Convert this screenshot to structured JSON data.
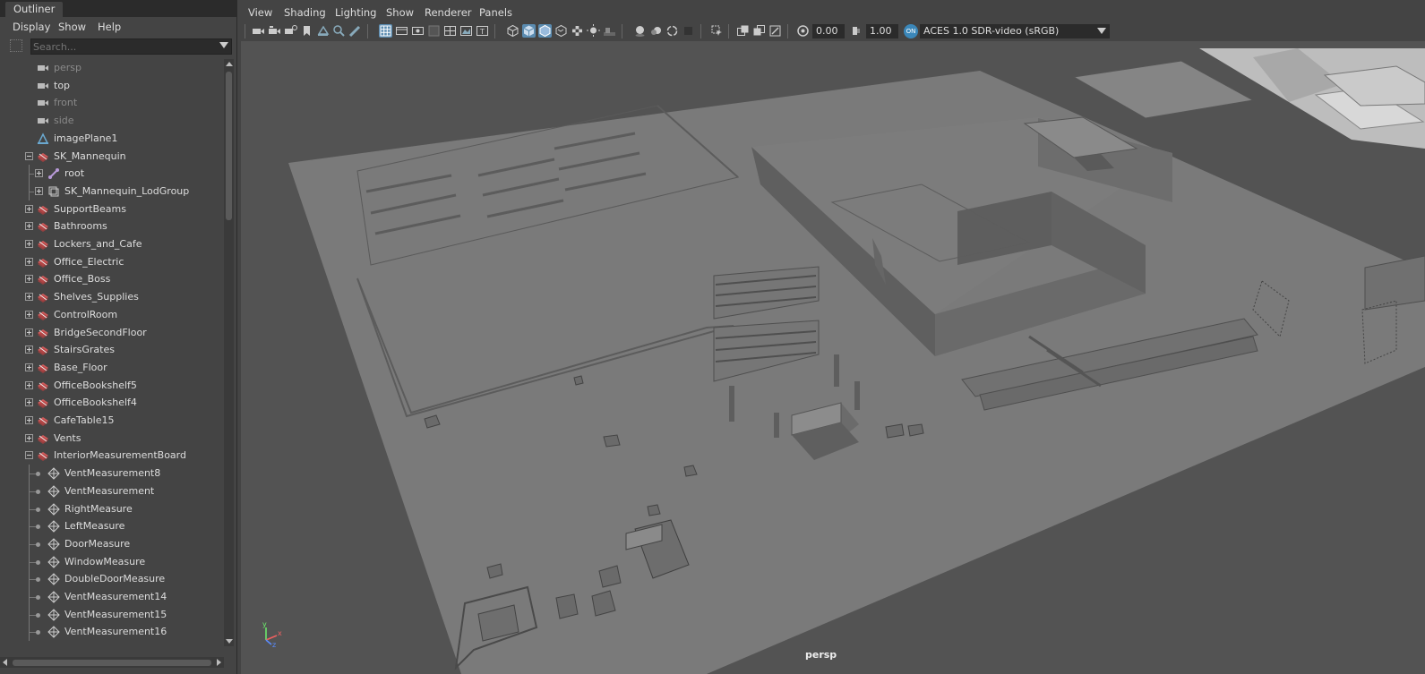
{
  "outliner": {
    "tab_title": "Outliner",
    "menus": [
      "Display",
      "Show",
      "Help"
    ],
    "search_placeholder": "Search...",
    "items": [
      {
        "label": "persp",
        "depth": 0,
        "icon": "camera-icon",
        "expander": "none",
        "dim": true
      },
      {
        "label": "top",
        "depth": 0,
        "icon": "camera-icon",
        "expander": "none",
        "dim": false
      },
      {
        "label": "front",
        "depth": 0,
        "icon": "camera-icon",
        "expander": "none",
        "dim": true
      },
      {
        "label": "side",
        "depth": 0,
        "icon": "camera-icon",
        "expander": "none",
        "dim": true
      },
      {
        "label": "imagePlane1",
        "depth": 0,
        "icon": "image-plane-icon",
        "expander": "none",
        "dim": false
      },
      {
        "label": "SK_Mannequin",
        "depth": 0,
        "icon": "group-icon",
        "expander": "minus",
        "dim": false
      },
      {
        "label": "root",
        "depth": 1,
        "icon": "joint-icon",
        "expander": "plus",
        "dim": false
      },
      {
        "label": "SK_Mannequin_LodGroup",
        "depth": 1,
        "icon": "lod-group-icon",
        "expander": "plus",
        "dim": false
      },
      {
        "label": "SupportBeams",
        "depth": 0,
        "icon": "group-icon",
        "expander": "plus",
        "dim": false
      },
      {
        "label": "Bathrooms",
        "depth": 0,
        "icon": "group-icon",
        "expander": "plus",
        "dim": false
      },
      {
        "label": "Lockers_and_Cafe",
        "depth": 0,
        "icon": "group-icon",
        "expander": "plus",
        "dim": false
      },
      {
        "label": "Office_Electric",
        "depth": 0,
        "icon": "group-icon",
        "expander": "plus",
        "dim": false
      },
      {
        "label": "Office_Boss",
        "depth": 0,
        "icon": "group-icon",
        "expander": "plus",
        "dim": false
      },
      {
        "label": "Shelves_Supplies",
        "depth": 0,
        "icon": "group-icon",
        "expander": "plus",
        "dim": false
      },
      {
        "label": "ControlRoom",
        "depth": 0,
        "icon": "group-icon",
        "expander": "plus",
        "dim": false
      },
      {
        "label": "BridgeSecondFloor",
        "depth": 0,
        "icon": "group-icon",
        "expander": "plus",
        "dim": false
      },
      {
        "label": "StairsGrates",
        "depth": 0,
        "icon": "group-icon",
        "expander": "plus",
        "dim": false
      },
      {
        "label": "Base_Floor",
        "depth": 0,
        "icon": "group-icon",
        "expander": "plus",
        "dim": false
      },
      {
        "label": "OfficeBookshelf5",
        "depth": 0,
        "icon": "group-icon",
        "expander": "plus",
        "dim": false
      },
      {
        "label": "OfficeBookshelf4",
        "depth": 0,
        "icon": "group-icon",
        "expander": "plus",
        "dim": false
      },
      {
        "label": "CafeTable15",
        "depth": 0,
        "icon": "group-icon",
        "expander": "plus",
        "dim": false
      },
      {
        "label": "Vents",
        "depth": 0,
        "icon": "group-icon",
        "expander": "plus",
        "dim": false
      },
      {
        "label": "InteriorMeasurementBoard",
        "depth": 0,
        "icon": "group-icon",
        "expander": "minus",
        "dim": false
      },
      {
        "label": "VentMeasurement8",
        "depth": 1,
        "icon": "locator-icon",
        "expander": "dot",
        "dim": false
      },
      {
        "label": "VentMeasurement",
        "depth": 1,
        "icon": "locator-icon",
        "expander": "dot",
        "dim": false
      },
      {
        "label": "RightMeasure",
        "depth": 1,
        "icon": "locator-icon",
        "expander": "dot",
        "dim": false
      },
      {
        "label": "LeftMeasure",
        "depth": 1,
        "icon": "locator-icon",
        "expander": "dot",
        "dim": false
      },
      {
        "label": "DoorMeasure",
        "depth": 1,
        "icon": "locator-icon",
        "expander": "dot",
        "dim": false
      },
      {
        "label": "WindowMeasure",
        "depth": 1,
        "icon": "locator-icon",
        "expander": "dot",
        "dim": false
      },
      {
        "label": "DoubleDoorMeasure",
        "depth": 1,
        "icon": "locator-icon",
        "expander": "dot",
        "dim": false
      },
      {
        "label": "VentMeasurement14",
        "depth": 1,
        "icon": "locator-icon",
        "expander": "dot",
        "dim": false
      },
      {
        "label": "VentMeasurement15",
        "depth": 1,
        "icon": "locator-icon",
        "expander": "dot",
        "dim": false
      },
      {
        "label": "VentMeasurement16",
        "depth": 1,
        "icon": "locator-icon",
        "expander": "dot",
        "dim": false
      }
    ]
  },
  "viewport": {
    "menus": [
      "View",
      "Shading",
      "Lighting",
      "Show",
      "Renderer",
      "Panels"
    ],
    "exposure_value": "0.00",
    "gamma_value": "1.00",
    "color_management_toggle": "ON",
    "color_space": "ACES 1.0 SDR-video (sRGB)",
    "camera_label": "persp",
    "axis_labels": {
      "y": "y",
      "x": "x",
      "z": "z"
    }
  },
  "colors": {
    "panel_bg": "#444444",
    "viewport_bg": "#535353",
    "ground": "#7a7a7a",
    "wall_light": "#8a8a8a",
    "wall_dark": "#656565",
    "accent_blue": "#5a8bb0",
    "cm_on": "#3b87b9"
  }
}
